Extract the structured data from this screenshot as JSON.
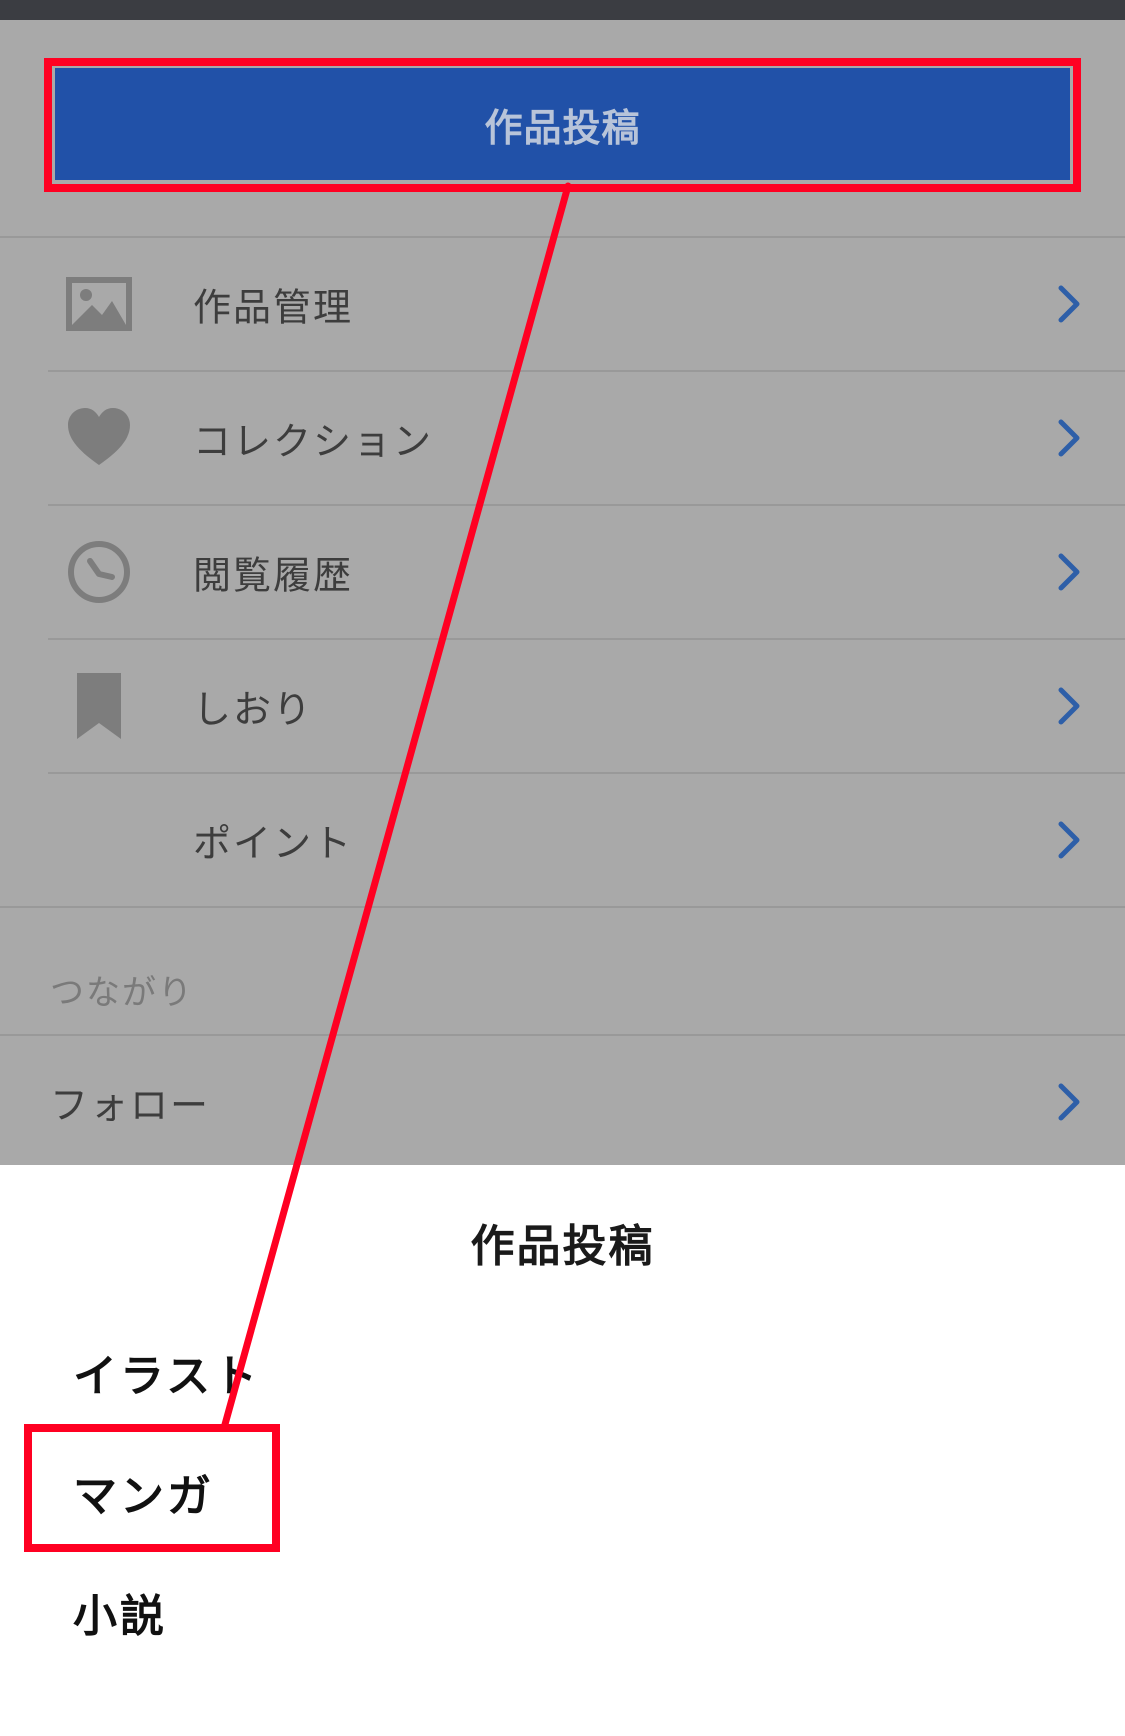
{
  "colors": {
    "accent": "#2151a8",
    "chevron": "#2e5fa8",
    "highlight": "#ff0022",
    "dim_background": "#a9a9a9"
  },
  "post_button": {
    "label": "作品投稿"
  },
  "menu": {
    "items": [
      {
        "label": "作品管理",
        "icon": "image-icon"
      },
      {
        "label": "コレクション",
        "icon": "heart-icon"
      },
      {
        "label": "閲覧履歴",
        "icon": "clock-icon"
      },
      {
        "label": "しおり",
        "icon": "bookmark-icon"
      },
      {
        "label": "ポイント",
        "icon": ""
      }
    ]
  },
  "connections": {
    "header": "つながり",
    "items": [
      {
        "label": "フォロー"
      }
    ]
  },
  "sheet": {
    "title": "作品投稿",
    "options": [
      {
        "label": "イラスト"
      },
      {
        "label": "マンガ"
      },
      {
        "label": "小説"
      }
    ]
  }
}
